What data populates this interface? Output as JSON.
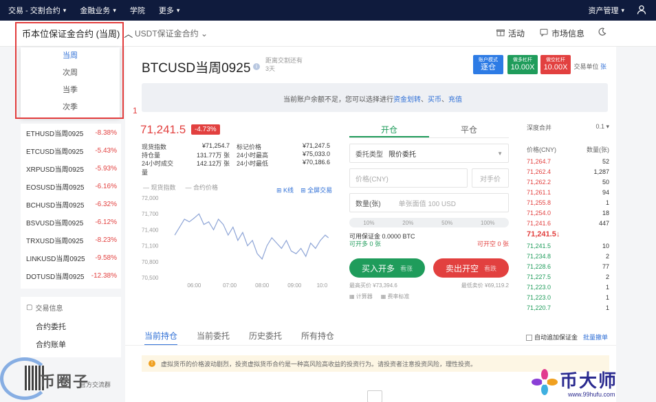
{
  "topbar": {
    "items": [
      "交易 - 交割合约",
      "金融业务",
      "学院",
      "更多"
    ],
    "right": "资产管理"
  },
  "subbar": {
    "contract_select": "币本位保证金合约 (当周)",
    "usdt_select": "USDT保证金合约",
    "activity": "活动",
    "market_info": "市场信息"
  },
  "dropdown": {
    "options": [
      "当周",
      "次周",
      "当季",
      "次季"
    ],
    "marker": "1"
  },
  "left_list": [
    {
      "name": "ETHUSD当周0925",
      "pct": "-8.38%"
    },
    {
      "name": "ETCUSD当周0925",
      "pct": "-5.43%"
    },
    {
      "name": "XRPUSD当周0925",
      "pct": "-5.93%"
    },
    {
      "name": "EOSUSD当周0925",
      "pct": "-6.16%"
    },
    {
      "name": "BCHUSD当周0925",
      "pct": "-6.32%"
    },
    {
      "name": "BSVUSD当周0925",
      "pct": "-6.12%"
    },
    {
      "name": "TRXUSD当周0925",
      "pct": "-8.23%"
    },
    {
      "name": "LINKUSD当周0925",
      "pct": "-9.58%"
    },
    {
      "name": "DOTUSD当周0925",
      "pct": "-12.38%"
    }
  ],
  "info_panel": {
    "header": "交易信息",
    "links": [
      "合约委托",
      "合约账单"
    ]
  },
  "header": {
    "title": "BTCUSD当周0925",
    "delivery_label": "距离交割还有",
    "delivery_value": "3天",
    "unit_label": "交易单位",
    "unit_value": "张"
  },
  "pills": [
    {
      "top": "账户模式",
      "bottom": "逐仓",
      "color": "#2d7be5"
    },
    {
      "top": "做多杠杆",
      "bottom": "10.00X",
      "color": "#1f9c5b"
    },
    {
      "top": "做空杠杆",
      "bottom": "10.00X",
      "color": "#e2403f"
    }
  ],
  "notice": {
    "text": "当前账户余额不足，您可以选择进行",
    "link1": "资金划转",
    "sep1": "、",
    "link2": "买币",
    "sep2": "、",
    "link3": "充值"
  },
  "ticker": {
    "price": "71,241.5",
    "change": "-4.73%"
  },
  "stats": [
    {
      "k1": "现货指数",
      "v1": "¥71,254.7",
      "k2": "标记价格",
      "v2": "¥71,247.5"
    },
    {
      "k1": "持仓量",
      "v1": "131.77万 张",
      "k2": "24小时最高",
      "v2": "¥75,033.0"
    },
    {
      "k1": "24小时成交量",
      "v1": "142.12万 张",
      "k2": "24小时最低",
      "v2": "¥70,186.6"
    }
  ],
  "chart_legend": [
    "现货指数",
    "合约价格"
  ],
  "chart_links": [
    "K线",
    "全屏交易"
  ],
  "chart_data": {
    "type": "line",
    "ylim": [
      70500,
      72000
    ],
    "y_ticks": [
      "72,000",
      "71,700",
      "71,400",
      "71,100",
      "70,800",
      "70,500"
    ],
    "x_ticks": [
      "06:00",
      "07:00",
      "08:00",
      "09:00",
      "10:0"
    ],
    "x_tick_positions": [
      5.9,
      7.0,
      8.0,
      9.0,
      9.9
    ],
    "xlim": [
      5.0,
      10.1
    ],
    "series": [
      {
        "x": [
          5.3,
          5.45,
          5.6,
          5.75,
          5.9,
          6.05,
          6.2,
          6.35,
          6.5,
          6.65,
          6.8,
          6.95,
          7.1,
          7.25,
          7.4,
          7.55,
          7.7,
          7.85,
          8.0,
          8.15,
          8.3,
          8.45,
          8.6,
          8.75,
          8.9,
          9.05,
          9.2,
          9.35,
          9.5,
          9.65,
          9.8,
          9.95,
          10.05
        ],
        "y": [
          71300,
          71450,
          71600,
          71550,
          71620,
          71700,
          71500,
          71550,
          71400,
          71600,
          71500,
          71300,
          71450,
          71200,
          71350,
          71100,
          71200,
          70950,
          70850,
          71100,
          71250,
          71150,
          71050,
          71200,
          71000,
          70950,
          71050,
          70900,
          71150,
          71050,
          71200,
          71300,
          71250
        ]
      }
    ]
  },
  "trade": {
    "tab_open": "开仓",
    "tab_close": "平仓",
    "order_type_label": "委托类型",
    "order_type_value": "限价委托",
    "price_placeholder": "价格(CNY)",
    "counter_price": "对手价",
    "qty_label": "数量(张)",
    "qty_placeholder": "单张面值 100 USD",
    "pcts": [
      "10%",
      "20%",
      "50%",
      "100%"
    ],
    "available": "可用保证金 0.0000 BTC",
    "can_long": "可开多 0 张",
    "can_short": "可开空 0 张",
    "buy_label": "买入开多",
    "buy_sub": "看涨",
    "sell_label": "卖出开空",
    "sell_sub": "看跌",
    "best_buy": "最高买价 ¥73,394.6",
    "best_sell": "最低卖价 ¥69,119.2",
    "calc": "计算器",
    "fee": "费率标准"
  },
  "book": {
    "depth_label": "深度合并",
    "depth_value": "0.1",
    "col_price": "价格(CNY)",
    "col_qty": "数量(张)",
    "asks": [
      {
        "p": "71,264.7",
        "q": "52"
      },
      {
        "p": "71,262.4",
        "q": "1,287"
      },
      {
        "p": "71,262.2",
        "q": "50"
      },
      {
        "p": "71,261.1",
        "q": "94"
      },
      {
        "p": "71,255.8",
        "q": "1"
      },
      {
        "p": "71,254.0",
        "q": "18"
      },
      {
        "p": "71,241.6",
        "q": "447"
      }
    ],
    "mid": "71,241.5↓",
    "bids": [
      {
        "p": "71,241.5",
        "q": "10"
      },
      {
        "p": "71,234.8",
        "q": "2"
      },
      {
        "p": "71,228.6",
        "q": "77"
      },
      {
        "p": "71,227.5",
        "q": "2"
      },
      {
        "p": "71,223.0",
        "q": "1"
      },
      {
        "p": "71,223.0",
        "q": "1"
      },
      {
        "p": "71,220.7",
        "q": "1"
      }
    ]
  },
  "bottom": {
    "tabs": [
      "当前持仓",
      "当前委托",
      "历史委托",
      "所有持仓"
    ],
    "auto_margin": "自动追加保证金",
    "batch_cancel": "批量撤单",
    "risk": "虚拟货币的价格波动剧烈，投资虚拟货币合约是一种高风险高收益的投资行为。请投资者注意投资风险，理性投资。"
  },
  "watermark": {
    "left": "币圈子",
    "left_sub": "官方交流群",
    "right": "币大师",
    "right_url": "www.99hufu.com"
  }
}
